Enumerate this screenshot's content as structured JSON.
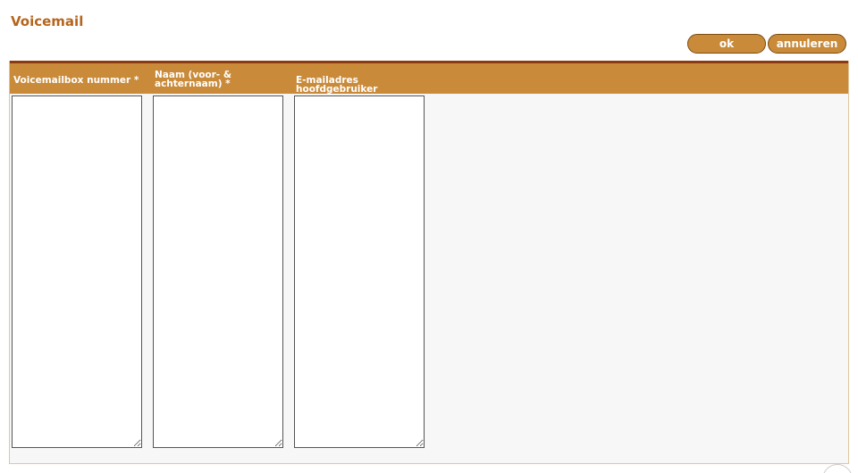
{
  "page": {
    "title": "Voicemail"
  },
  "toolbar": {
    "ok_label": "ok",
    "cancel_label": "annuleren"
  },
  "form": {
    "columns": [
      {
        "label": "Voicemailbox nummer *",
        "value": ""
      },
      {
        "label": "Naam (voor- & achternaam) *",
        "value": ""
      },
      {
        "label": "E-mailadres hoofdgebruiker",
        "value": ""
      }
    ]
  },
  "colors": {
    "title": "#b5651d",
    "header_bg": "#c98b3a",
    "header_border": "#8b3a10",
    "button_bg": "#c98b3a",
    "panel_bg": "#f7f7f7"
  }
}
